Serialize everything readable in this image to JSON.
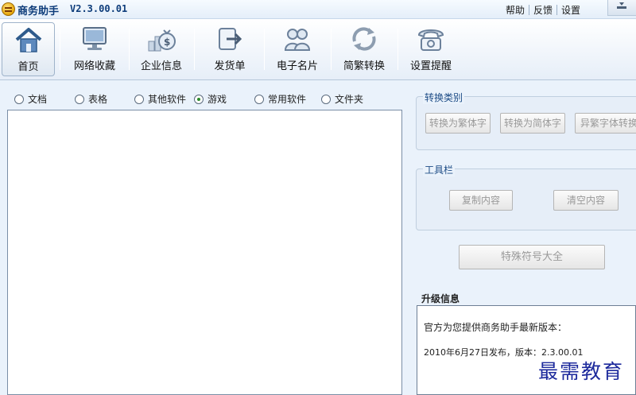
{
  "app": {
    "title": "商务助手",
    "version": "V2.3.00.01"
  },
  "top_links": [
    "帮助",
    "反馈",
    "设置"
  ],
  "toolbar": [
    {
      "label": "首页",
      "icon": "home-icon"
    },
    {
      "label": "网络收藏",
      "icon": "monitor-icon"
    },
    {
      "label": "企业信息",
      "icon": "money-bag-icon"
    },
    {
      "label": "发货单",
      "icon": "export-icon"
    },
    {
      "label": "电子名片",
      "icon": "contacts-icon"
    },
    {
      "label": "简繁转换",
      "icon": "convert-arrows-icon"
    },
    {
      "label": "设置提醒",
      "icon": "telephone-icon"
    }
  ],
  "categories": [
    "文档",
    "表格",
    "其他软件",
    "游戏",
    "常用软件",
    "文件夹"
  ],
  "selected_category": "游戏",
  "convert_group": {
    "title": "转换类别",
    "buttons": [
      "转换为繁体字",
      "转换为简体字",
      "异繁字体转换"
    ]
  },
  "tools_group": {
    "title": "工具栏",
    "buttons": [
      "复制内容",
      "清空内容"
    ]
  },
  "special_symbols_button": "特殊符号大全",
  "upgrade": {
    "title": "升级信息",
    "line1": "官方为您提供商务助手最新版本：",
    "line2": "2010年6月27日发布，版本：2.3.00.01"
  },
  "watermark": "最需教育",
  "colors": {
    "title_text": "#0d3c7a",
    "group_title": "#1d4c86",
    "watermark": "#1d2a9c"
  }
}
